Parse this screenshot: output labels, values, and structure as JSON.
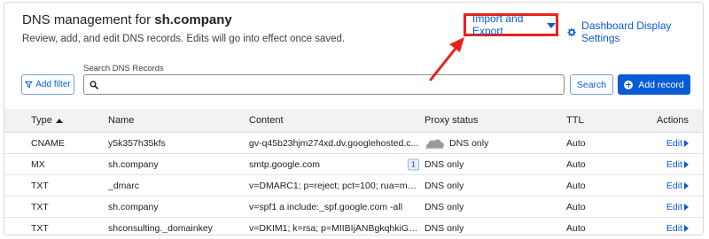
{
  "header": {
    "title_prefix": "DNS management for ",
    "domain": "sh.company",
    "subtitle": "Review, add, and edit DNS records. Edits will go into effect once saved.",
    "import_export_label": "Import and Export",
    "dashboard_settings_label": "Dashboard Display Settings"
  },
  "search": {
    "label": "Search DNS Records",
    "value": "",
    "placeholder": ""
  },
  "toolbar": {
    "add_filter_label": "Add filter",
    "search_button_label": "Search",
    "add_record_label": "Add record"
  },
  "table": {
    "headers": {
      "type": "Type",
      "name": "Name",
      "content": "Content",
      "proxy": "Proxy status",
      "ttl": "TTL",
      "actions": "Actions"
    },
    "rows": [
      {
        "type": "CNAME",
        "name": "y5k357h35kfs",
        "content": "gv-q45b23hjm274xd.dv.googlehosted.c...",
        "badge": "",
        "proxy": "DNS only",
        "ttl": "Auto",
        "action": "Edit"
      },
      {
        "type": "MX",
        "name": "sh.company",
        "content": "smtp.google.com",
        "badge": "1",
        "proxy": "DNS only",
        "ttl": "Auto",
        "action": "Edit"
      },
      {
        "type": "TXT",
        "name": "_dmarc",
        "content": "v=DMARC1; p=reject; pct=100; rua=mail...",
        "badge": "",
        "proxy": "DNS only",
        "ttl": "Auto",
        "action": "Edit"
      },
      {
        "type": "TXT",
        "name": "sh.company",
        "content": "v=spf1 a include:_spf.google.com -all",
        "badge": "",
        "proxy": "DNS only",
        "ttl": "Auto",
        "action": "Edit"
      },
      {
        "type": "TXT",
        "name": "shconsulting._domainkey",
        "content": "v=DKIM1; k=rsa; p=MIIBIjANBgkqhkiG9w...",
        "badge": "",
        "proxy": "DNS only",
        "ttl": "Auto",
        "action": "Edit"
      }
    ]
  },
  "colors": {
    "accent": "#0a5bd6",
    "highlight": "#e8231b",
    "header_bg": "#f2f2f2"
  }
}
